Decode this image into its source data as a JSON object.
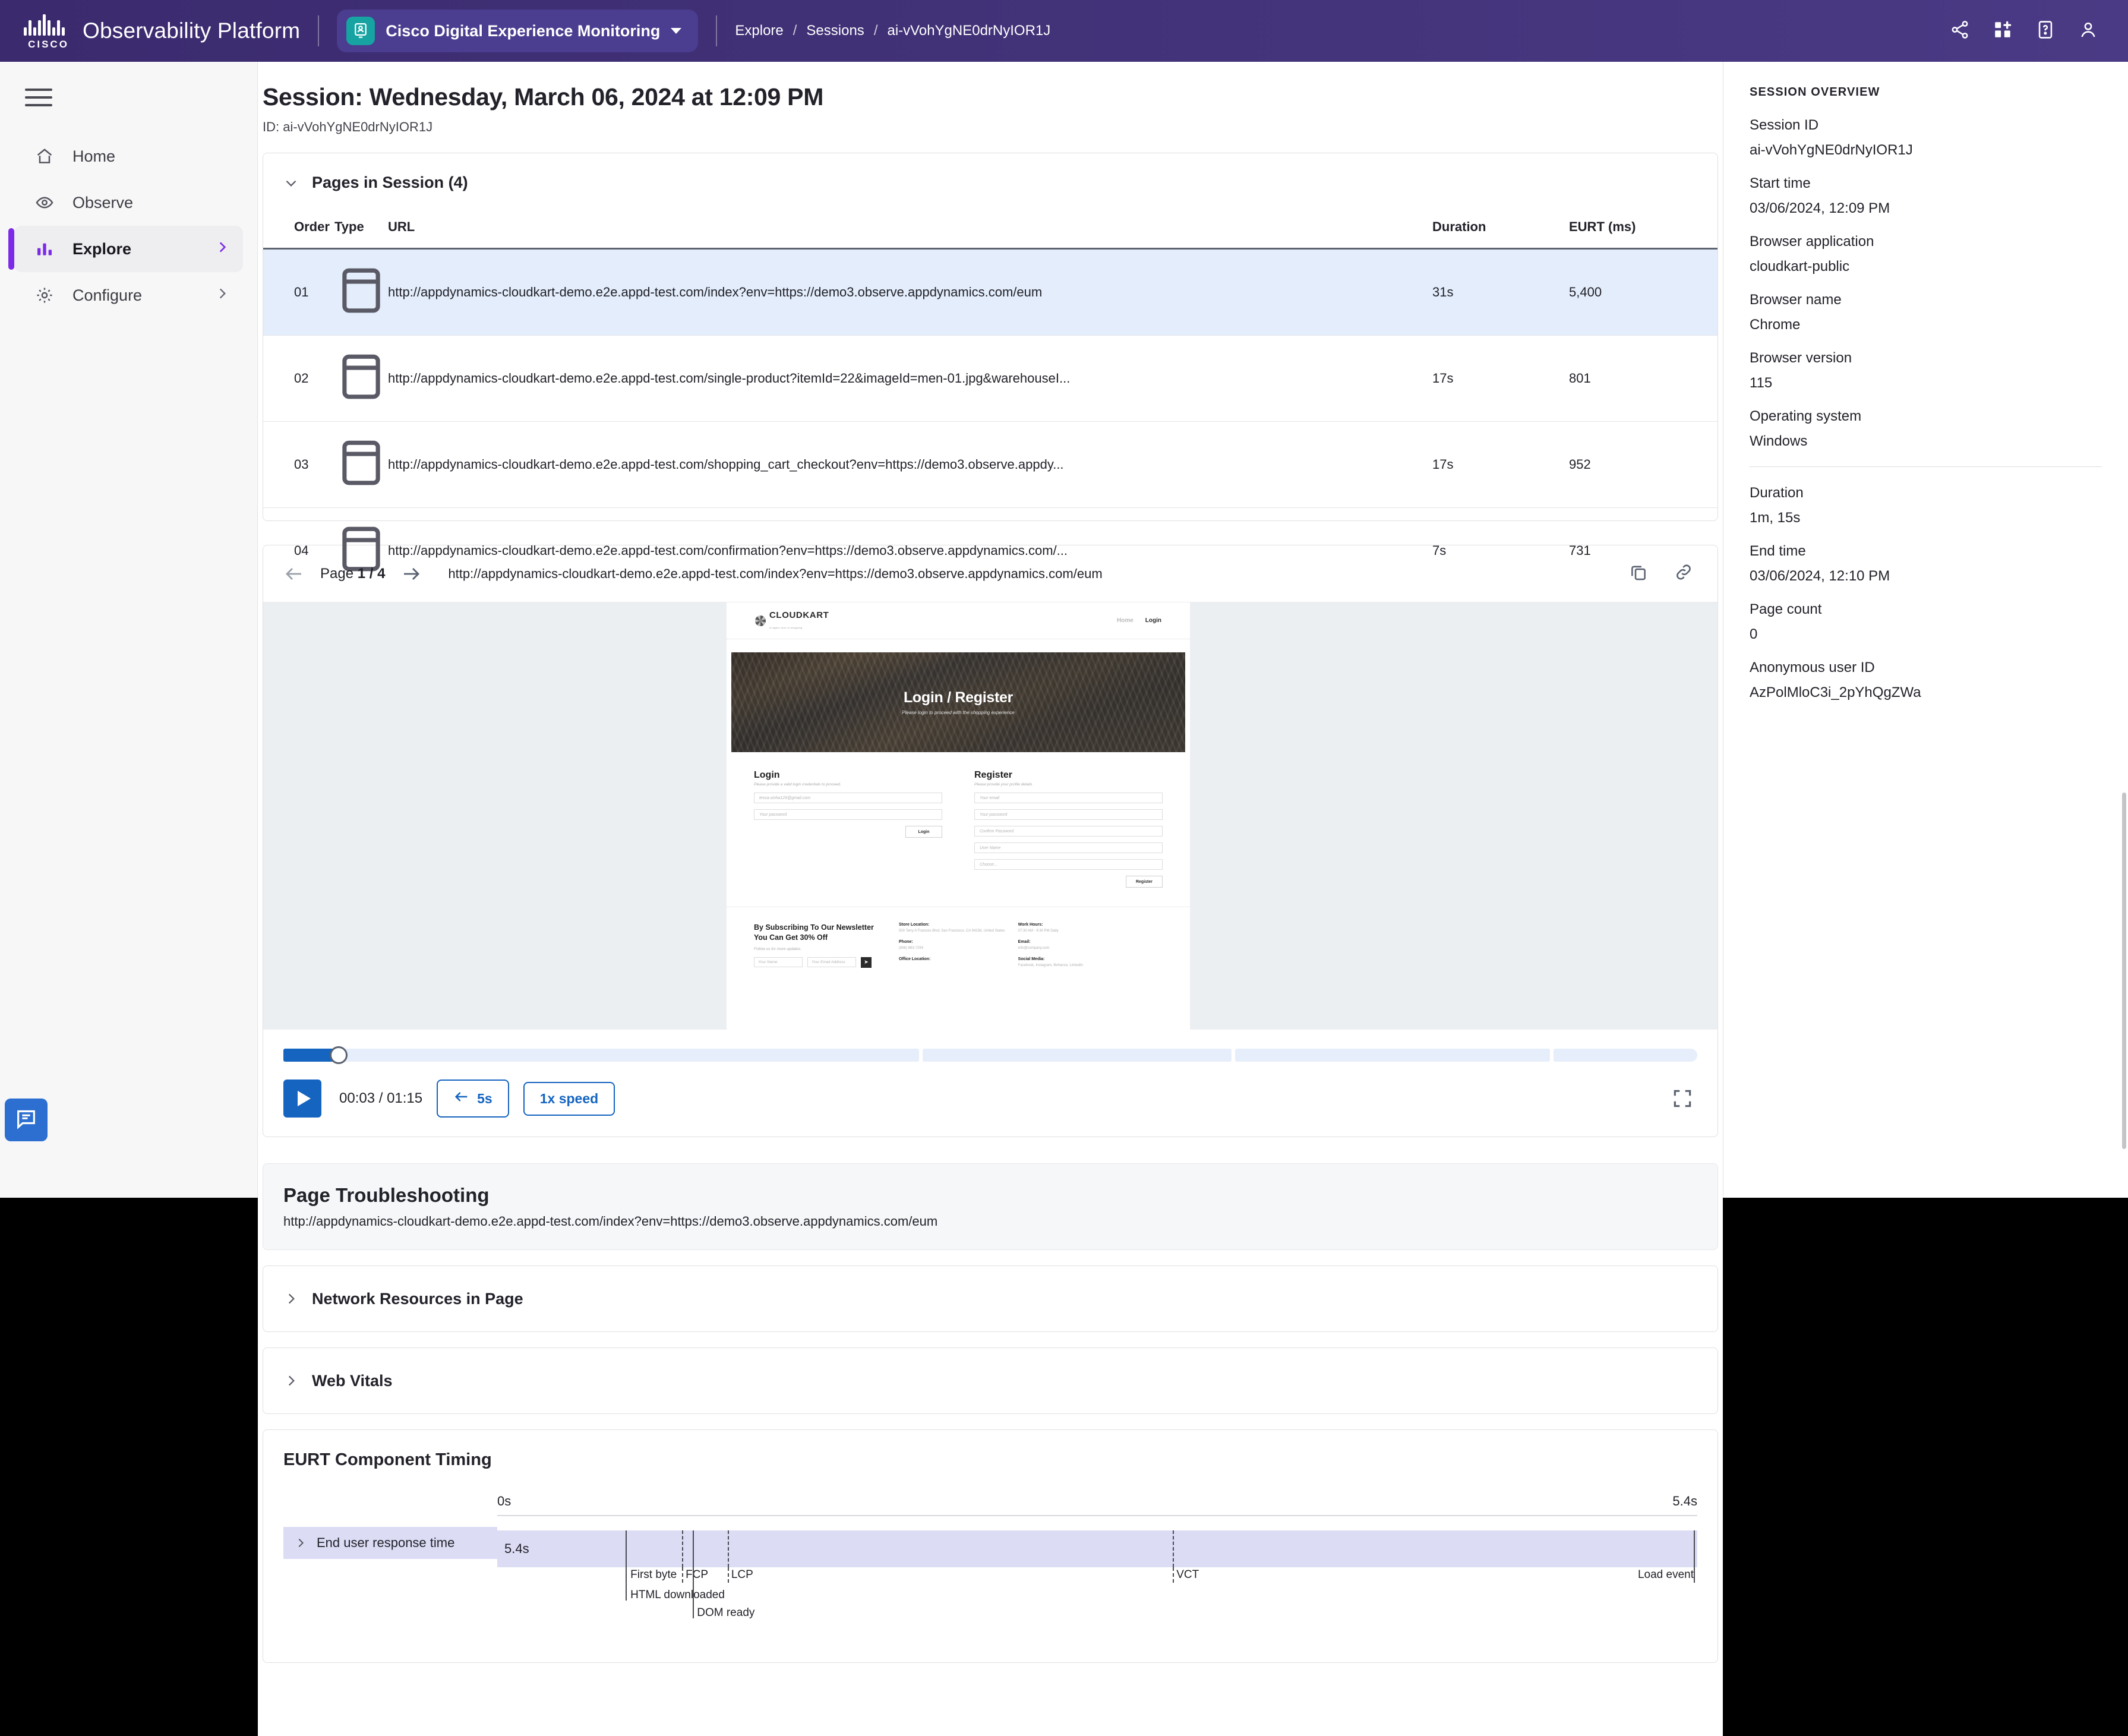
{
  "topbar": {
    "brand": "Observability Platform",
    "cisco_word": "CISCO",
    "product": "Cisco Digital Experience Monitoring",
    "breadcrumb": [
      "Explore",
      "Sessions",
      "ai-vVohYgNE0drNyIOR1J"
    ],
    "sep": "/",
    "icons": [
      "share-icon",
      "apps-add-icon",
      "help-icon",
      "user-account-icon"
    ]
  },
  "sidebar": {
    "items": [
      {
        "label": "Home",
        "icon": "home-icon",
        "active": false,
        "chevron": false
      },
      {
        "label": "Observe",
        "icon": "eye-icon",
        "active": false,
        "chevron": false
      },
      {
        "label": "Explore",
        "icon": "bar-chart-icon",
        "active": true,
        "chevron": true
      },
      {
        "label": "Configure",
        "icon": "gear-icon",
        "active": false,
        "chevron": true
      }
    ],
    "feedback_icon": "feedback-chat-icon"
  },
  "page": {
    "title": "Session: Wednesday, March 06, 2024 at 12:09 PM",
    "subtitle": "ID: ai-vVohYgNE0drNyIOR1J"
  },
  "pages_section": {
    "title": "Pages in Session (4)",
    "columns": [
      "Order",
      "Type",
      "URL",
      "Duration",
      "EURT (ms)"
    ],
    "rows": [
      {
        "order": "01",
        "type_icon": "browser-window-icon",
        "url": "http://appdynamics-cloudkart-demo.e2e.appd-test.com/index?env=https://demo3.observe.appdynamics.com/eum",
        "duration": "31s",
        "eurt": "5,400",
        "selected": true
      },
      {
        "order": "02",
        "type_icon": "browser-window-icon",
        "url": "http://appdynamics-cloudkart-demo.e2e.appd-test.com/single-product?itemId=22&imageId=men-01.jpg&warehouseI...",
        "duration": "17s",
        "eurt": "801",
        "selected": false
      },
      {
        "order": "03",
        "type_icon": "browser-window-icon",
        "url": "http://appdynamics-cloudkart-demo.e2e.appd-test.com/shopping_cart_checkout?env=https://demo3.observe.appdy...",
        "duration": "17s",
        "eurt": "952",
        "selected": false
      },
      {
        "order": "04",
        "type_icon": "browser-window-icon",
        "url": "http://appdynamics-cloudkart-demo.e2e.appd-test.com/confirmation?env=https://demo3.observe.appdynamics.com/...",
        "duration": "7s",
        "eurt": "731",
        "selected": false
      }
    ]
  },
  "player": {
    "page_label": "Page",
    "page_position": "1 / 4",
    "url": "http://appdynamics-cloudkart-demo.e2e.appd-test.com/index?env=https://demo3.observe.appdynamics.com/eum",
    "copy_icon": "copy-icon",
    "link_icon": "link-icon",
    "timecode": "00:03 / 01:15",
    "rewind_label": "5s",
    "speed_label": "1x speed",
    "play_icon": "play-icon",
    "fullscreen_icon": "fullscreen-icon",
    "progress_percent": 4
  },
  "replay": {
    "brand": "CLOUDKART",
    "tagline": "A higher form of shopping",
    "nav": [
      "Home",
      "Login"
    ],
    "hero_title": "Login / Register",
    "hero_sub": "Please login to proceed with the shopping experience",
    "login": {
      "heading": "Login",
      "sub": "Please provide a valid login credentials to proceed.",
      "email_placeholder": "leeza.sinha126@gmail.com",
      "password_placeholder": "Your password",
      "button": "Login"
    },
    "register": {
      "heading": "Register",
      "sub": "Please provide your profile details",
      "fields": [
        "Your email",
        "Your password",
        "Confirm Password",
        "User Name",
        "Choose..."
      ],
      "button": "Register"
    },
    "newsletter": {
      "heading": "By Subscribing To Our Newsletter You Can Get 30% Off",
      "sub": "Follow us for more updates.",
      "name_placeholder": "Your Name",
      "email_placeholder": "Your Email Address",
      "send_icon": "send-icon"
    },
    "info": [
      {
        "label": "Store Location:",
        "value": "500 Terry A Francois Blvd, San Francisco, CA 94158, United States"
      },
      {
        "label": "Phone:",
        "value": "(866) 883-7254"
      },
      {
        "label": "Office Location:",
        "value": ""
      },
      {
        "label": "Work Hours:",
        "value": "07:30 AM - 9:30 PM Daily"
      },
      {
        "label": "Email:",
        "value": "info@company.com"
      },
      {
        "label": "Social Media:",
        "value": "Facebook, Instagram, Behance, LinkedIn"
      }
    ]
  },
  "troubleshooting": {
    "title": "Page Troubleshooting",
    "url": "http://appdynamics-cloudkart-demo.e2e.appd-test.com/index?env=https://demo3.observe.appdynamics.com/eum",
    "sections": [
      "Network Resources in Page",
      "Web Vitals"
    ]
  },
  "session_overview": {
    "heading": "SESSION OVERVIEW",
    "fields": [
      {
        "label": "Session ID",
        "value": "ai-vVohYgNE0drNyIOR1J"
      },
      {
        "label": "Start time",
        "value": "03/06/2024, 12:09 PM"
      },
      {
        "label": "Browser application",
        "value": "cloudkart-public"
      },
      {
        "label": "Browser name",
        "value": "Chrome"
      },
      {
        "label": "Browser version",
        "value": "115"
      },
      {
        "label": "Operating system",
        "value": "Windows"
      }
    ],
    "fields2": [
      {
        "label": "Duration",
        "value": "1m, 15s"
      },
      {
        "label": "End time",
        "value": "03/06/2024, 12:10 PM"
      },
      {
        "label": "Page count",
        "value": "0"
      },
      {
        "label": "Anonymous user ID",
        "value": "AzPolMloC3i_2pYhQgZWa"
      }
    ]
  },
  "chart_data": {
    "type": "bar",
    "title": "EURT Component Timing",
    "row_label": "End user response time",
    "axis_start": "0s",
    "axis_end": "5.4s",
    "bar_label": "5.4s",
    "xlim": [
      0,
      5.4
    ],
    "xlabel": "",
    "ylabel": "",
    "grid": false,
    "series": [
      {
        "name": "End user response time",
        "value": 5.4,
        "unit": "s"
      }
    ],
    "markers": [
      {
        "name": "First byte",
        "t": 0.58,
        "style": "solid"
      },
      {
        "name": "HTML downloaded",
        "t": 0.58,
        "style": "solid"
      },
      {
        "name": "FCP",
        "t": 0.83,
        "style": "dashed"
      },
      {
        "name": "DOM ready",
        "t": 0.88,
        "style": "solid"
      },
      {
        "name": "LCP",
        "t": 1.04,
        "style": "dashed"
      },
      {
        "name": "VCT",
        "t": 3.04,
        "style": "dashed"
      },
      {
        "name": "Load event",
        "t": 5.4,
        "style": "solid"
      }
    ]
  },
  "colors": {
    "header_purple": "#413177",
    "accent_purple": "#7d2ae8",
    "product_teal": "#18a3a3",
    "primary_blue": "#1464c0",
    "row_selected": "#e3edfb",
    "bar_lavender": "#dcdcf5"
  }
}
